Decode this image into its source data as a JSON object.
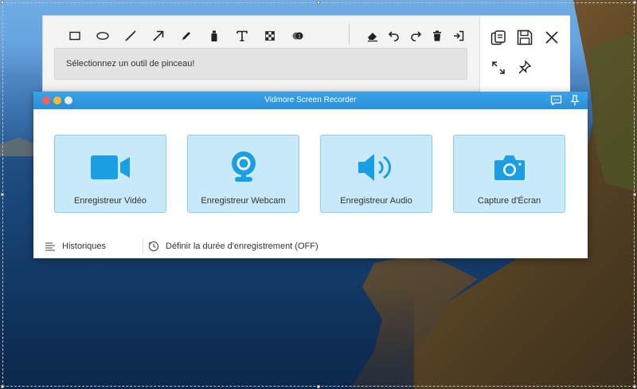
{
  "toolbar": {
    "draw_tools": [
      {
        "name": "rectangle-icon"
      },
      {
        "name": "ellipse-icon"
      },
      {
        "name": "line-icon"
      },
      {
        "name": "arrow-icon"
      },
      {
        "name": "pencil-icon"
      },
      {
        "name": "highlighter-icon"
      },
      {
        "name": "text-icon"
      },
      {
        "name": "mosaic-icon"
      },
      {
        "name": "number-marker-icon"
      }
    ],
    "edit_tools": [
      {
        "name": "eraser-icon"
      },
      {
        "name": "undo-icon"
      },
      {
        "name": "redo-icon"
      },
      {
        "name": "trash-icon"
      },
      {
        "name": "exit-icon"
      }
    ],
    "hint": "Sélectionnez un outil de pinceau!",
    "side_actions": [
      {
        "name": "copy-icon"
      },
      {
        "name": "save-icon"
      },
      {
        "name": "close-icon"
      },
      {
        "name": "fullscreen-icon"
      },
      {
        "name": "pin-icon"
      }
    ]
  },
  "recorder": {
    "title": "Vidmore Screen Recorder",
    "accent": "#2a8ed8",
    "card_color": "#c8e9f9",
    "modes": [
      {
        "label": "Enregistreur Vidéo",
        "icon": "video-camera-icon"
      },
      {
        "label": "Enregistreur Webcam",
        "icon": "webcam-icon"
      },
      {
        "label": "Enregistreur Audio",
        "icon": "speaker-icon"
      },
      {
        "label": "Capture d'Écran",
        "icon": "camera-icon"
      }
    ],
    "bottom": {
      "history_label": "Historiques",
      "timer_label": "Définir la durée d'enregistrement (OFF)"
    }
  }
}
